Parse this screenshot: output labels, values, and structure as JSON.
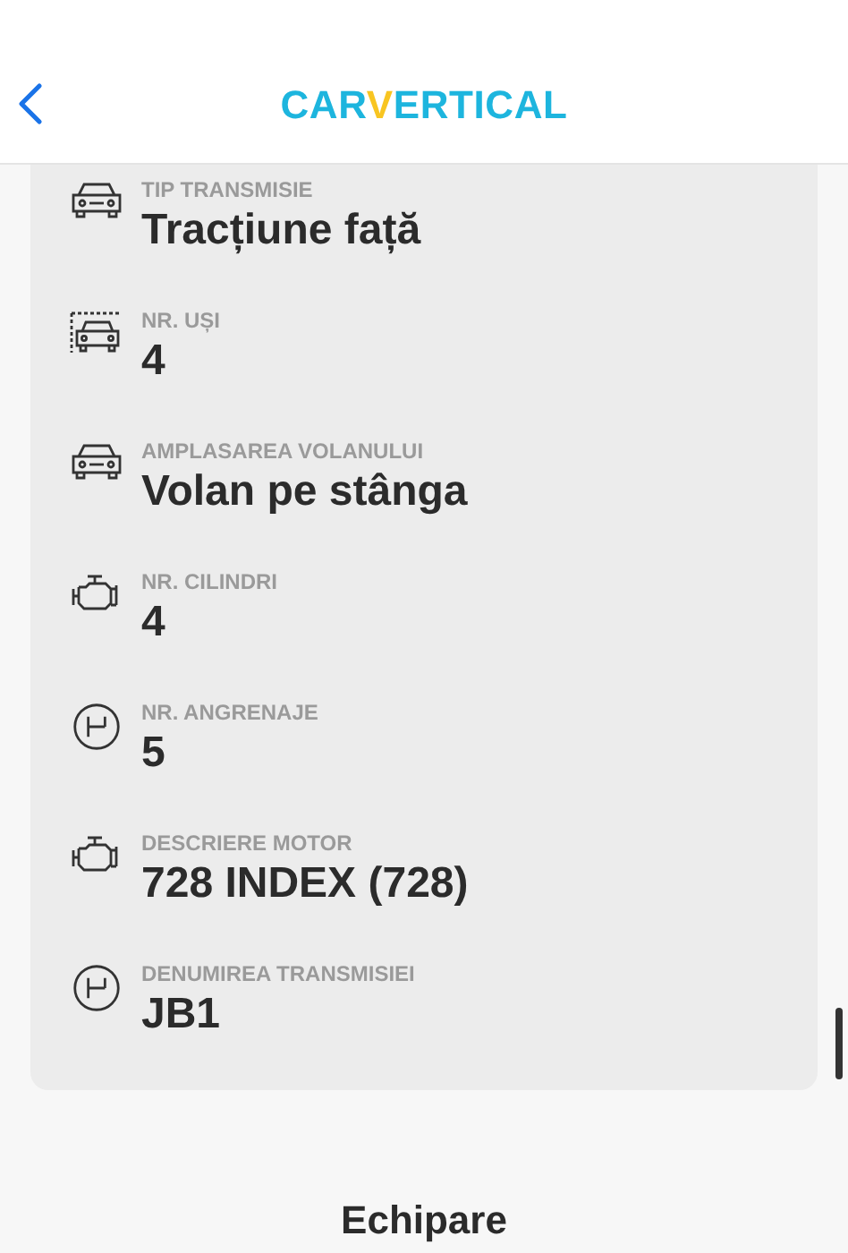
{
  "header": {
    "logo": [
      {
        "text": "CAR",
        "color": "#1db5de"
      },
      {
        "text": "V",
        "color": "#f8c521"
      },
      {
        "text": "ERTICAL",
        "color": "#1db5de"
      }
    ]
  },
  "specs": [
    {
      "kind": "car",
      "label": "TIP TRANSMISIE",
      "value": "Tracțiune față"
    },
    {
      "kind": "doors",
      "label": "NR. UȘI",
      "value": "4"
    },
    {
      "kind": "car",
      "label": "AMPLASAREA VOLANULUI",
      "value": "Volan pe stânga"
    },
    {
      "kind": "engine",
      "label": "NR. CILINDRI",
      "value": "4"
    },
    {
      "kind": "gearbox",
      "label": "NR. ANGRENAJE",
      "value": "5"
    },
    {
      "kind": "engine",
      "label": "DESCRIERE MOTOR",
      "value": "728 INDEX (728)"
    },
    {
      "kind": "gearbox",
      "label": "DENUMIREA TRANSMISIEI",
      "value": "JB1"
    }
  ],
  "section_title": "Echipare"
}
